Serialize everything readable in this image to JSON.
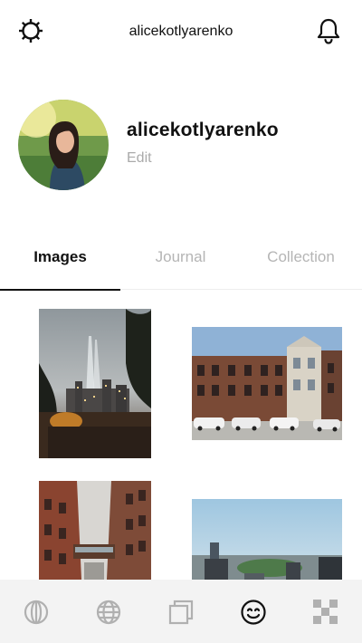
{
  "header": {
    "title": "alicekotlyarenko",
    "left_icon": "settings-gear-icon",
    "right_icon": "notification-bell-icon"
  },
  "profile": {
    "username": "alicekotlyarenko",
    "edit_label": "Edit"
  },
  "tabs": [
    {
      "label": "Images",
      "active": true
    },
    {
      "label": "Journal",
      "active": false
    },
    {
      "label": "Collection",
      "active": false
    }
  ],
  "grid": {
    "photos": [
      {
        "subject": "tribute-in-light-night-city-photo"
      },
      {
        "subject": "brownstone-street-photo"
      },
      {
        "subject": "brick-alley-skybridge-photo"
      },
      {
        "subject": "central-park-skyline-photo"
      }
    ]
  },
  "tabbar": {
    "items": [
      {
        "icon": "columns-globe-icon",
        "active": false
      },
      {
        "icon": "globe-icon",
        "active": false
      },
      {
        "icon": "stacked-squares-icon",
        "active": false
      },
      {
        "icon": "smiley-icon",
        "active": true
      },
      {
        "icon": "checker-grid-icon",
        "active": false
      }
    ]
  },
  "colors": {
    "text_primary": "#111111",
    "text_muted": "#b5b5b5",
    "tabbar_bg": "#f3f3f3",
    "tabbar_icon": "#b0b0b0"
  }
}
